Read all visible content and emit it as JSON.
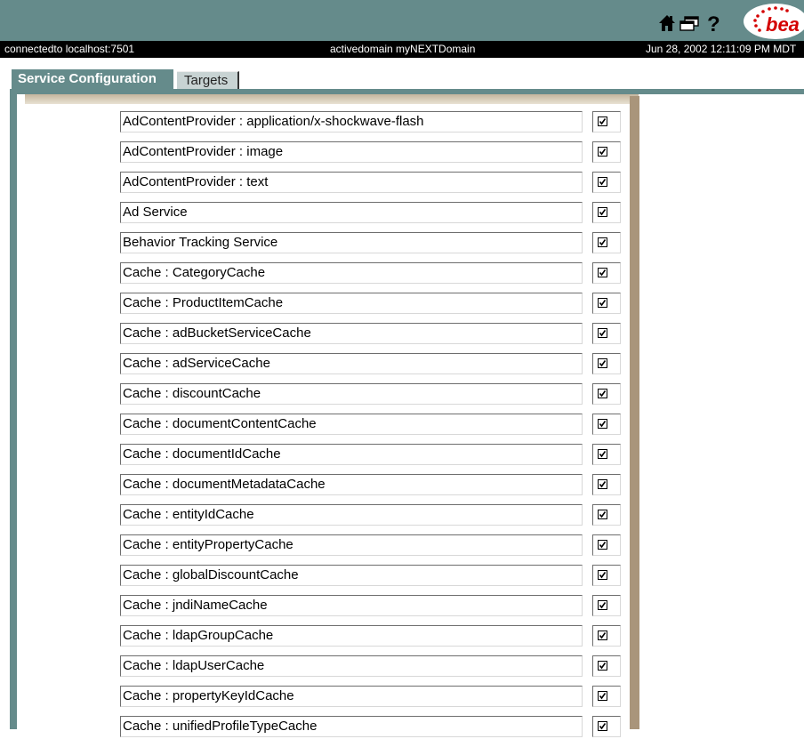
{
  "header": {
    "icons": [
      "home-icon",
      "windows-icon",
      "help-icon"
    ],
    "logo_text": "bea",
    "accent_color": "#658B8B"
  },
  "status": {
    "connection": "connectedto localhost:7501",
    "domain": "activedomain myNEXTDomain",
    "datetime": "Jun 28, 2002 12:11:09 PM MDT"
  },
  "tabs": [
    {
      "label": "Service Configuration",
      "active": true
    },
    {
      "label": "Targets",
      "active": false
    }
  ],
  "services": [
    {
      "label": "AdContentProvider : application/x-shockwave-flash",
      "checked": true
    },
    {
      "label": "AdContentProvider : image",
      "checked": true
    },
    {
      "label": "AdContentProvider : text",
      "checked": true
    },
    {
      "label": "Ad Service",
      "checked": true
    },
    {
      "label": "Behavior Tracking Service",
      "checked": true
    },
    {
      "label": "Cache : CategoryCache",
      "checked": true
    },
    {
      "label": "Cache : ProductItemCache",
      "checked": true
    },
    {
      "label": "Cache : adBucketServiceCache",
      "checked": true
    },
    {
      "label": "Cache : adServiceCache",
      "checked": true
    },
    {
      "label": "Cache : discountCache",
      "checked": true
    },
    {
      "label": "Cache : documentContentCache",
      "checked": true
    },
    {
      "label": "Cache : documentIdCache",
      "checked": true
    },
    {
      "label": "Cache : documentMetadataCache",
      "checked": true
    },
    {
      "label": "Cache : entityIdCache",
      "checked": true
    },
    {
      "label": "Cache : entityPropertyCache",
      "checked": true
    },
    {
      "label": "Cache : globalDiscountCache",
      "checked": true
    },
    {
      "label": "Cache : jndiNameCache",
      "checked": true
    },
    {
      "label": "Cache : ldapGroupCache",
      "checked": true
    },
    {
      "label": "Cache : ldapUserCache",
      "checked": true
    },
    {
      "label": "Cache : propertyKeyIdCache",
      "checked": true
    },
    {
      "label": "Cache : unifiedProfileTypeCache",
      "checked": true
    }
  ]
}
